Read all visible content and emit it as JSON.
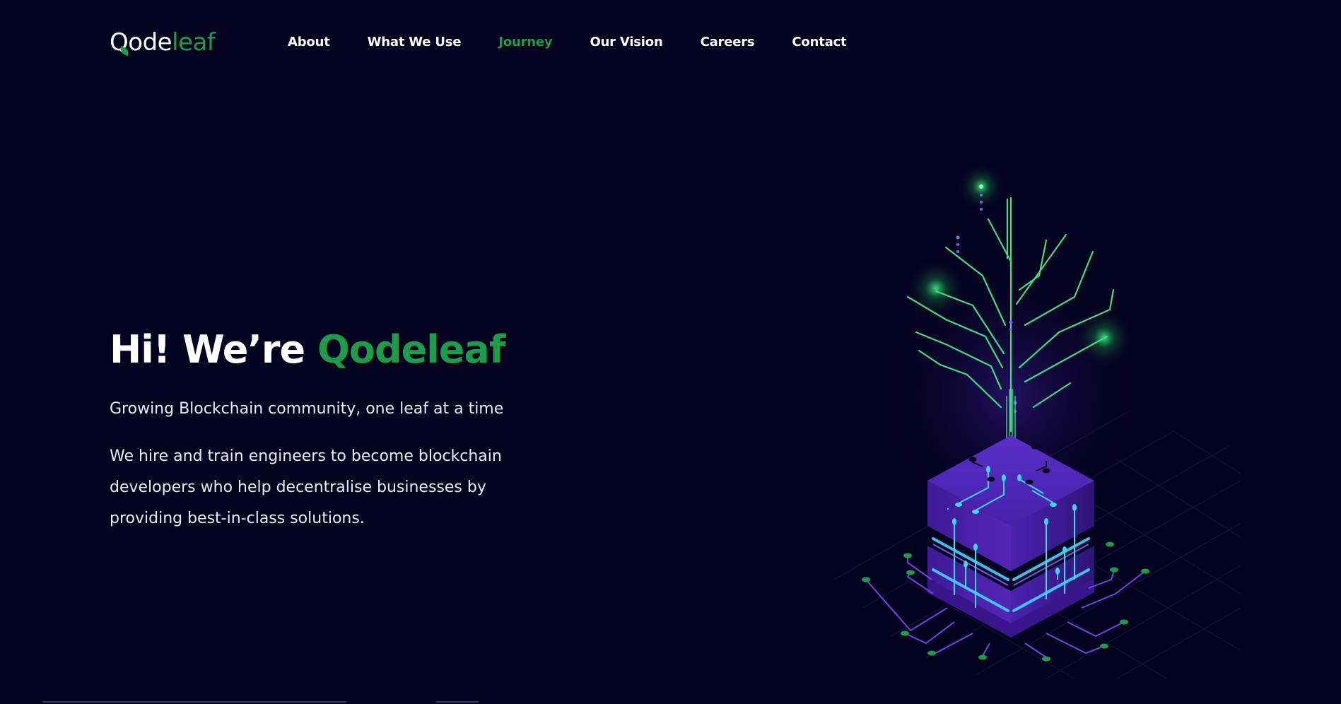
{
  "brand": {
    "logo_q": "Q",
    "logo_ode": "ode",
    "logo_leaf": "leaf",
    "accent_color": "#1a9e4a",
    "background_color": "#05021f"
  },
  "nav": {
    "items": [
      {
        "label": "About",
        "active": false
      },
      {
        "label": "What We Use",
        "active": false
      },
      {
        "label": "Journey",
        "active": true
      },
      {
        "label": "Our Vision",
        "active": false
      },
      {
        "label": "Careers",
        "active": false
      },
      {
        "label": "Contact",
        "active": false
      }
    ]
  },
  "hero": {
    "title_prefix": "Hi! We’re ",
    "title_accent": "Qodeleaf",
    "tagline": "Growing Blockchain community, one leaf at a time",
    "description": "We hire and train engineers to become blockchain developers who help decentralise businesses by providing best-in-class solutions."
  },
  "illustration": {
    "icon": "blockchain-tree-cube-illustration"
  }
}
